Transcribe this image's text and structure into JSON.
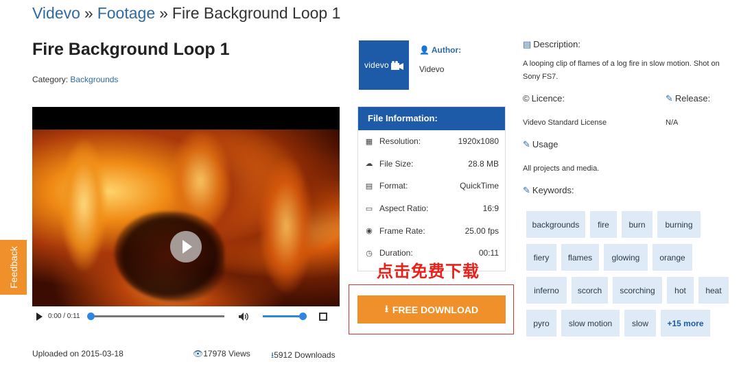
{
  "breadcrumb": {
    "home": "Videvo",
    "section": "Footage",
    "current": "Fire Background Loop 1",
    "sep": "»"
  },
  "title": "Fire Background Loop 1",
  "category": {
    "label": "Category:",
    "value": "Backgrounds"
  },
  "player": {
    "time": "0:00 / 0:11"
  },
  "meta": {
    "uploaded": "Uploaded on 2015-03-18",
    "views": "17978 Views",
    "downloads": "5912 Downloads"
  },
  "author": {
    "logo_text": "videvo",
    "label": "Author:",
    "name": "Videvo"
  },
  "file_info": {
    "header": "File Information:",
    "rows": [
      {
        "label": "Resolution:",
        "value": "1920x1080",
        "icon": "film-icon"
      },
      {
        "label": "File Size:",
        "value": "28.8 MB",
        "icon": "cloud-download-icon"
      },
      {
        "label": "Format:",
        "value": "QuickTime",
        "icon": "file-icon"
      },
      {
        "label": "Aspect Ratio:",
        "value": "16:9",
        "icon": "monitor-icon"
      },
      {
        "label": "Frame Rate:",
        "value": "25.00 fps",
        "icon": "camera-icon"
      },
      {
        "label": "Duration:",
        "value": "00:11",
        "icon": "clock-icon"
      }
    ]
  },
  "annotation_text": "点击免费下载",
  "download_label": "FREE DOWNLOAD",
  "feedback_label": "Feedback",
  "description": {
    "label": "Description:",
    "text": "A looping clip of flames of a log fire in slow motion. Shot on Sony FS7."
  },
  "licence": {
    "label": "Licence:",
    "value": "Videvo Standard License"
  },
  "release": {
    "label": "Release:",
    "value": "N/A"
  },
  "usage": {
    "label": "Usage",
    "value": "All projects and media."
  },
  "keywords": {
    "label": "Keywords:",
    "items": [
      "backgrounds",
      "fire",
      "burn",
      "burning",
      "fiery",
      "flames",
      "glowing",
      "orange",
      "inferno",
      "scorch",
      "scorching",
      "hot",
      "heat",
      "pyro",
      "slow motion",
      "slow",
      "+15 more"
    ]
  },
  "colors": {
    "brand_blue": "#1d5aa8",
    "accent_orange": "#f0902a",
    "link_blue": "#2f6aa3",
    "annotation_red": "#e8211a"
  }
}
